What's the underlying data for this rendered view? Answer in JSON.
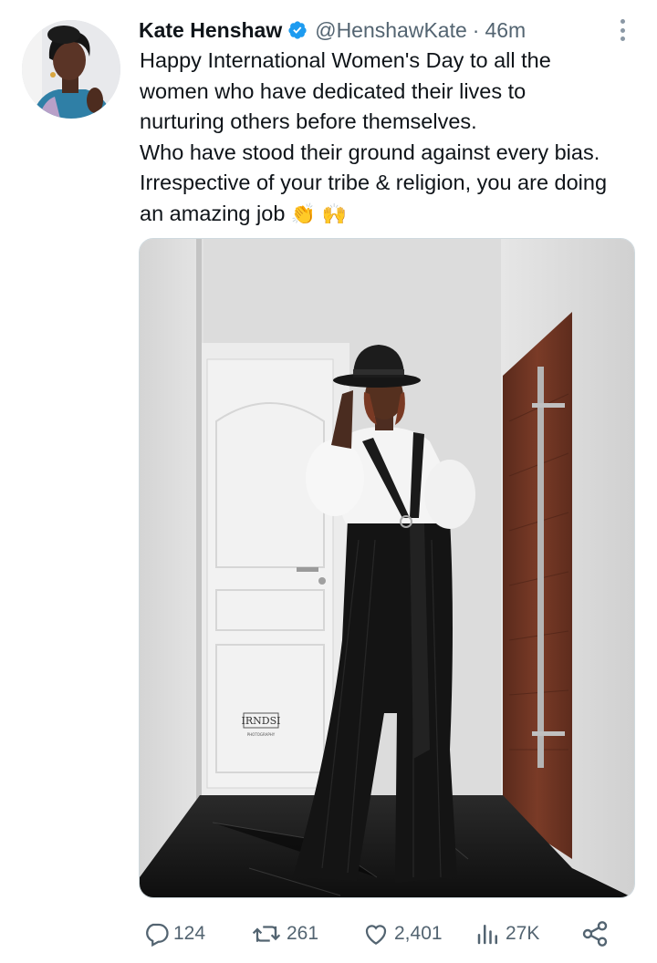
{
  "tweet": {
    "author": {
      "name": "Kate Henshaw",
      "handle": "@HenshawKate",
      "separator": "·",
      "time": "46m",
      "verified": true
    },
    "text_lines": [
      "Happy International Women's Day to all the",
      "women who have dedicated their lives to",
      "nurturing others before themselves.",
      "Who have stood their ground against every bias.",
      "Irrespective of your tribe & religion, you are doing",
      "an amazing job"
    ],
    "emojis": [
      "👏",
      "🙌"
    ],
    "media": {
      "watermark": "IRNDSI",
      "watermark_sub": "PHOTOGRAPHY"
    },
    "actions": {
      "replies": "124",
      "retweets": "261",
      "likes": "2,401",
      "views": "27K"
    }
  },
  "icons": [
    "verified-badge-icon",
    "more-icon",
    "reply-icon",
    "retweet-icon",
    "like-icon",
    "views-icon",
    "share-icon"
  ],
  "colors": {
    "verified": "#1d9bf0",
    "text_primary": "#0f1419",
    "text_secondary": "#536471",
    "door_wood": "#6b3322"
  }
}
